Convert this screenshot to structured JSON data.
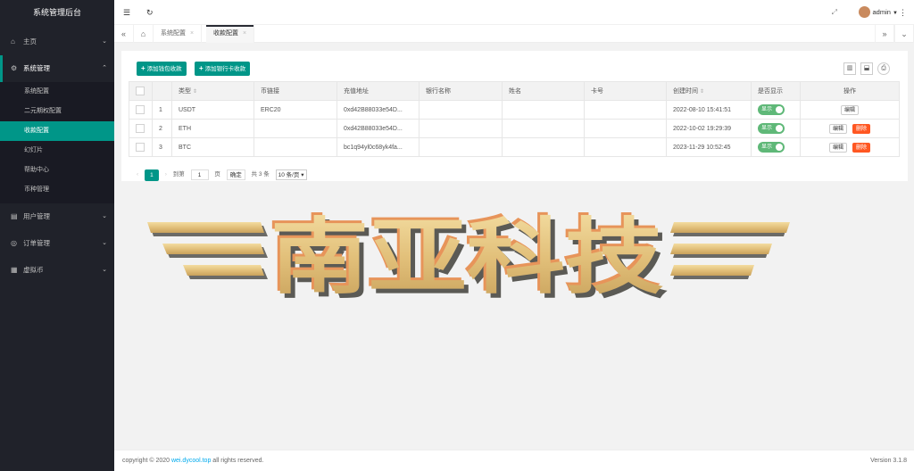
{
  "app": {
    "title": "系统管理后台"
  },
  "sidebar": {
    "items": [
      {
        "label": "主页",
        "icon": "home-icon"
      },
      {
        "label": "系统管理",
        "icon": "gear-icon",
        "open": true,
        "children": [
          "系统配置",
          "二元期权配置",
          "收款配置",
          "幻灯片",
          "帮助中心",
          "币种管理"
        ]
      },
      {
        "label": "用户管理",
        "icon": "users-icon"
      },
      {
        "label": "订单管理",
        "icon": "orders-icon"
      },
      {
        "label": "虚拟币",
        "icon": "coin-icon"
      }
    ]
  },
  "header": {
    "user": "admin"
  },
  "tabs": [
    {
      "label": "系统配置"
    },
    {
      "label": "收款配置",
      "active": true
    }
  ],
  "toolbar": {
    "add_wallet": "添加钱包收款",
    "add_bank": "添加银行卡收款"
  },
  "table": {
    "columns": [
      "类型",
      "币链接",
      "充值地址",
      "银行名称",
      "姓名",
      "卡号",
      "创建时间",
      "是否显示",
      "操作"
    ],
    "rows": [
      {
        "no": "1",
        "type": "USDT",
        "chain": "ERC20",
        "addr": "0xd42B88033e54D...",
        "bank": "",
        "name": "",
        "card": "",
        "time": "2022-08-10 15:41:51",
        "show": "显示",
        "edit": "编辑",
        "del": ""
      },
      {
        "no": "2",
        "type": "ETH",
        "chain": "",
        "addr": "0xd42B88033e54D...",
        "bank": "",
        "name": "",
        "card": "",
        "time": "2022-10-02 19:29:39",
        "show": "显示",
        "edit": "编辑",
        "del": "删除"
      },
      {
        "no": "3",
        "type": "BTC",
        "chain": "",
        "addr": "bc1q94yl0c68yk4fa...",
        "bank": "",
        "name": "",
        "card": "",
        "time": "2023-11-29 10:52:45",
        "show": "显示",
        "edit": "编辑",
        "del": "删除"
      }
    ]
  },
  "pager": {
    "current": "1",
    "goto_label": "到第",
    "goto_value": "1",
    "page_unit": "页",
    "confirm": "确定",
    "total": "共 3 条",
    "per_page": "10 条/页"
  },
  "banner": {
    "text": "南亚科技"
  },
  "footer": {
    "copyright_prefix": "copyright © 2020",
    "link": "wei.dycool.top",
    "copyright_suffix": "all rights reserved.",
    "version": "Version 3.1.8"
  },
  "colors": {
    "accent": "#009688",
    "sidebar": "#20222a",
    "danger": "#ff5722",
    "switch_on": "#5fb878"
  }
}
